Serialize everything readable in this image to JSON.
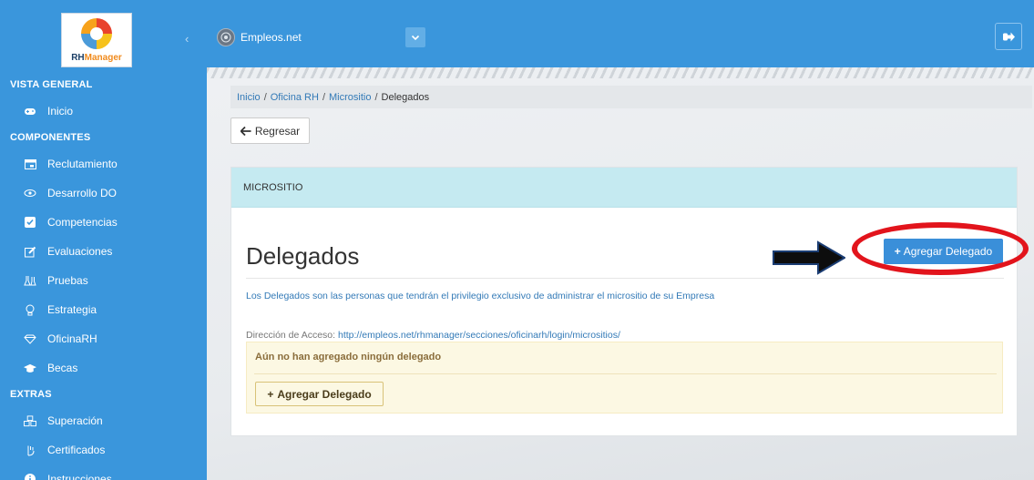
{
  "app": {
    "logo_text_main": "RH",
    "logo_text_accent": "Manager",
    "company": "Empleos.net"
  },
  "sidebar": {
    "collapse_icon": "chevron-left-icon",
    "sections": [
      {
        "title": "VISTA GENERAL",
        "items": [
          {
            "label": "Inicio",
            "icon": "gamepad-icon"
          }
        ]
      },
      {
        "title": "COMPONENTES",
        "items": [
          {
            "label": "Reclutamiento",
            "icon": "calendar-icon"
          },
          {
            "label": "Desarrollo DO",
            "icon": "eye-icon"
          },
          {
            "label": "Competencias",
            "icon": "check-square-icon"
          },
          {
            "label": "Evaluaciones",
            "icon": "edit-icon"
          },
          {
            "label": "Pruebas",
            "icon": "flask-icon"
          },
          {
            "label": "Estrategia",
            "icon": "lightbulb-icon"
          },
          {
            "label": "OficinaRH",
            "icon": "diamond-icon"
          },
          {
            "label": "Becas",
            "icon": "graduation-cap-icon"
          }
        ]
      },
      {
        "title": "EXTRAS",
        "items": [
          {
            "label": "Superación",
            "icon": "cubes-icon"
          },
          {
            "label": "Certificados",
            "icon": "hand-icon"
          },
          {
            "label": "Instrucciones",
            "icon": "info-circle-icon"
          }
        ]
      }
    ]
  },
  "topbar": {
    "dropdown_icon": "chevron-down-icon",
    "logout_icon": "sign-out-icon"
  },
  "breadcrumb": [
    "Inicio",
    "Oficina RH",
    "Micrositio",
    "Delegados"
  ],
  "back_button": {
    "label": "Regresar",
    "icon": "arrow-left-icon"
  },
  "panel": {
    "header": "MICROSITIO",
    "title": "Delegados",
    "add_button_label": "Agregar Delegado",
    "description": "Los Delegados son las personas que tendrán el privilegio exclusivo de administrar el micrositio de su Empresa",
    "access_label": "Dirección de Acceso:",
    "access_url": "http://empleos.net/rhmanager/secciones/oficinarh/login/micrositios/",
    "empty_message": "Aún no han agregado ningún delegado",
    "empty_add_button_label": "Agregar Delegado"
  },
  "colors": {
    "sidebar": "#3a96dc",
    "primary_button": "#3a8fd9",
    "annotation": "#e2141c",
    "warning_bg": "#fcf8e3"
  }
}
